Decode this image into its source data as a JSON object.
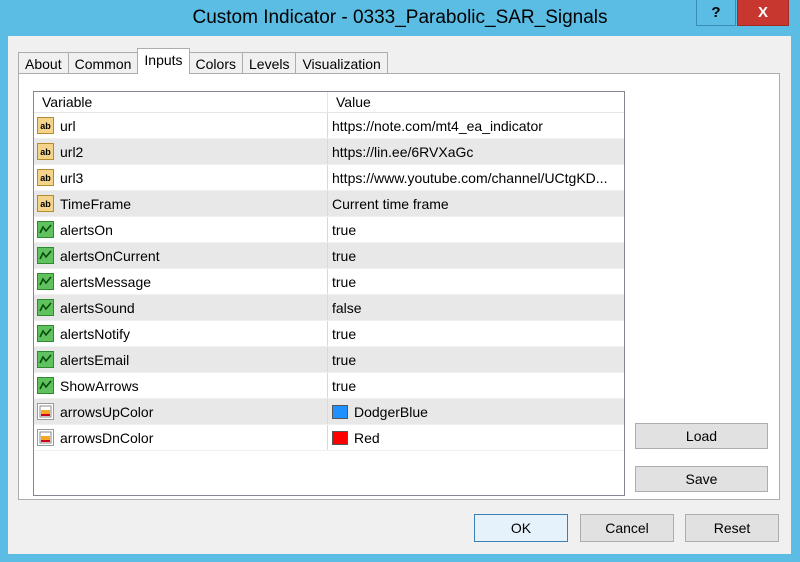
{
  "window": {
    "title": "Custom Indicator - 0333_Parabolic_SAR_Signals",
    "help_label": "?",
    "close_label": "X"
  },
  "tabs": [
    {
      "label": "About"
    },
    {
      "label": "Common"
    },
    {
      "label": "Inputs"
    },
    {
      "label": "Colors"
    },
    {
      "label": "Levels"
    },
    {
      "label": "Visualization"
    }
  ],
  "active_tab": "Inputs",
  "table": {
    "headers": {
      "variable": "Variable",
      "value": "Value"
    },
    "rows": [
      {
        "name": "url",
        "value": "https://note.com/mt4_ea_indicator",
        "icon": "string-icon"
      },
      {
        "name": "url2",
        "value": "https://lin.ee/6RVXaGc",
        "icon": "string-icon"
      },
      {
        "name": "url3",
        "value": "https://www.youtube.com/channel/UCtgKD...",
        "icon": "string-icon"
      },
      {
        "name": "TimeFrame",
        "value": "Current time frame",
        "icon": "string-icon"
      },
      {
        "name": "alertsOn",
        "value": "true",
        "icon": "bool-icon"
      },
      {
        "name": "alertsOnCurrent",
        "value": "true",
        "icon": "bool-icon"
      },
      {
        "name": "alertsMessage",
        "value": "true",
        "icon": "bool-icon"
      },
      {
        "name": "alertsSound",
        "value": "false",
        "icon": "bool-icon"
      },
      {
        "name": "alertsNotify",
        "value": "true",
        "icon": "bool-icon"
      },
      {
        "name": "alertsEmail",
        "value": "true",
        "icon": "bool-icon"
      },
      {
        "name": "ShowArrows",
        "value": "true",
        "icon": "bool-icon"
      },
      {
        "name": "arrowsUpColor",
        "value": "DodgerBlue",
        "icon": "color-icon",
        "swatch": "#1e90ff"
      },
      {
        "name": "arrowsDnColor",
        "value": "Red",
        "icon": "color-icon",
        "swatch": "#ff0000"
      }
    ]
  },
  "buttons": {
    "load": "Load",
    "save": "Save",
    "ok": "OK",
    "cancel": "Cancel",
    "reset": "Reset"
  }
}
